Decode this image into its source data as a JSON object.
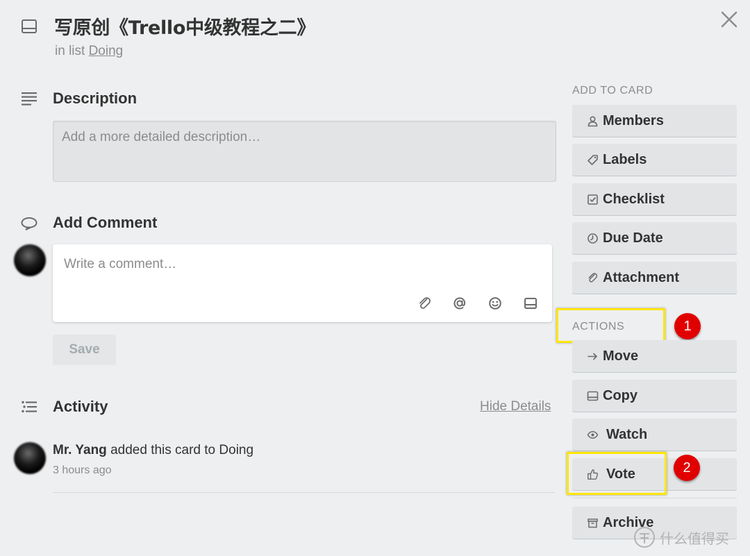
{
  "card": {
    "title": "写原创《Trello中级教程之二》",
    "in_list_prefix": "in list",
    "list_name": "Doing"
  },
  "description": {
    "heading": "Description",
    "placeholder": "Add a more detailed description…"
  },
  "comment": {
    "heading": "Add Comment",
    "placeholder": "Write a comment…",
    "save_label": "Save"
  },
  "activity": {
    "heading": "Activity",
    "hide_details_label": "Hide Details",
    "entries": [
      {
        "user": "Mr. Yang",
        "text": "added this card to Doing",
        "time": "3 hours ago"
      }
    ]
  },
  "sidebar": {
    "add_to_card_label": "ADD TO CARD",
    "add_items": [
      {
        "label": "Members",
        "icon": "person-icon"
      },
      {
        "label": "Labels",
        "icon": "tag-icon"
      },
      {
        "label": "Checklist",
        "icon": "checkbox-icon"
      },
      {
        "label": "Due Date",
        "icon": "clock-icon"
      },
      {
        "label": "Attachment",
        "icon": "paperclip-icon"
      }
    ],
    "actions_label": "ACTIONS",
    "action_items": [
      {
        "label": "Move",
        "icon": "arrow-right-icon"
      },
      {
        "label": "Copy",
        "icon": "card-icon"
      },
      {
        "label": "Watch",
        "icon": "eye-icon"
      },
      {
        "label": "Vote",
        "icon": "thumbs-up-icon"
      },
      {
        "label": "Archive",
        "icon": "archive-icon"
      }
    ]
  },
  "annotations": {
    "marker_1": "1",
    "marker_2": "2",
    "highlight_color": "#ffe600",
    "marker_color": "#e10000"
  },
  "watermark": {
    "text": "什么值得买"
  }
}
